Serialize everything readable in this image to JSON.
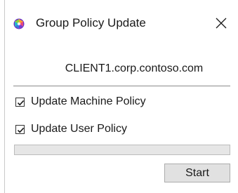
{
  "window": {
    "title": "Group Policy Update",
    "icon": "group-policy-icon",
    "close_icon": "close-icon"
  },
  "computer_name": "CLIENT1.corp.contoso.com",
  "options": [
    {
      "label": "Update Machine Policy",
      "checked": true
    },
    {
      "label": "Update User Policy",
      "checked": true
    }
  ],
  "progress": {
    "value": 0
  },
  "buttons": {
    "start_label": "Start"
  },
  "colors": {
    "progress_track": "#e6e6e6",
    "button_face": "#e1e1e1",
    "separator": "#8a8a8a"
  }
}
